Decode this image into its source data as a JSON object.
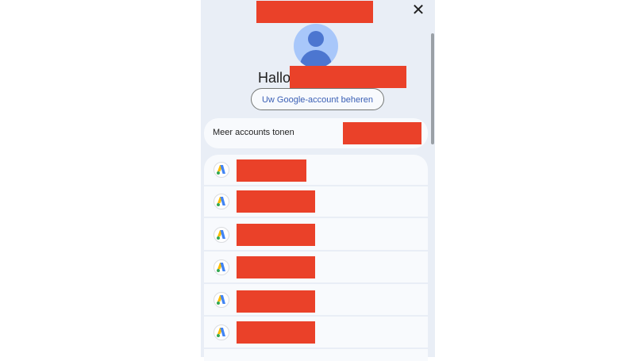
{
  "dialog": {
    "close_label": "✕",
    "greeting": "Hallo,",
    "manage_account_label": "Uw Google-account beheren",
    "more_accounts_label": "Meer accounts tonen"
  },
  "accounts": [
    {
      "icon": "google-ads-icon"
    },
    {
      "icon": "google-ads-icon"
    },
    {
      "icon": "google-ads-icon"
    },
    {
      "icon": "google-ads-icon"
    },
    {
      "icon": "google-ads-icon"
    },
    {
      "icon": "google-ads-icon"
    }
  ],
  "colors": {
    "panel_bg": "#e9eef6",
    "redaction": "#ea4129",
    "accent": "#3a5fb5",
    "avatar_bg": "#a8c7fa",
    "avatar_fg": "#4c76d0"
  }
}
